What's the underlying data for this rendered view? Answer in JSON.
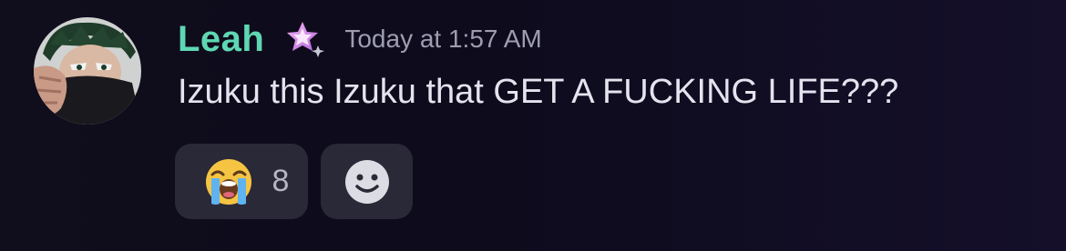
{
  "message": {
    "author": "Leah",
    "timestamp": "Today at 1:57 AM",
    "text": "Izuku this Izuku that GET A FUCKING LIFE???",
    "avatar_icon": "anime-character-avatar",
    "badge_icon": "nitro-star-badge-icon"
  },
  "reactions": [
    {
      "emoji": "loudly-crying-face",
      "count": "8"
    }
  ],
  "add_reaction_icon": "smiley-add-reaction-icon",
  "colors": {
    "username": "#5fd7b2",
    "timestamp": "#9e9db0",
    "text": "#e4e3ee",
    "reaction_bg": "#2a2937",
    "background": "#0d0b1c",
    "badge": "#e9a0f0"
  }
}
